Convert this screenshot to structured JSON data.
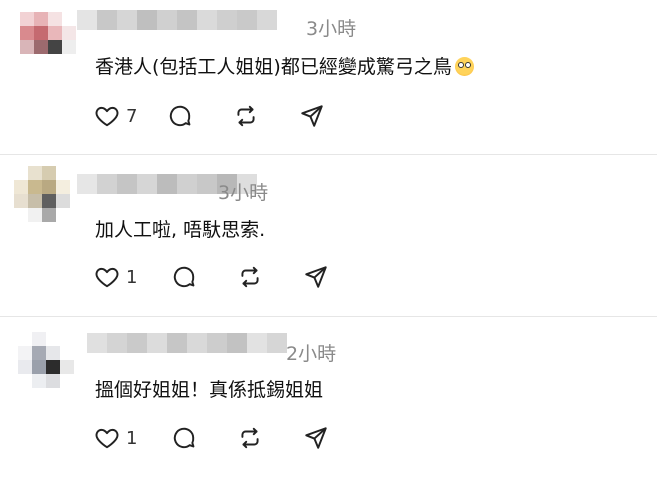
{
  "comments": [
    {
      "time": "3小時",
      "text": "香港人(包括工人姐姐)都已經變成驚弓之鳥",
      "emoji": "flushed-face-emoji",
      "like_count": "7",
      "avatar_colors": [
        "#f2d2d4",
        "#e7b3b6",
        "#f5e2e3",
        "#ffffff",
        "#d98a8e",
        "#c56a70",
        "#e9b7ba",
        "#f4e6e7",
        "#d9b5b8",
        "#9c6a6e",
        "#444444",
        "#eeeeee",
        "#ffffff",
        "#ffffff",
        "#ffffff",
        "#ffffff"
      ],
      "name_colors": [
        "#e4e4e4",
        "#c8c8c8",
        "#d6d6d6",
        "#bfbfbf",
        "#d0d0d0",
        "#c4c4c4",
        "#dadada",
        "#cfcfcf",
        "#c9c9c9",
        "#d8d8d8"
      ]
    },
    {
      "time": "3小時",
      "text": "加人工啦, 唔馱思索.",
      "like_count": "1",
      "avatar_colors": [
        "#ffffff",
        "#e8e1cf",
        "#d6ccb0",
        "#ffffff",
        "#efe7d5",
        "#c9b98f",
        "#b9a982",
        "#f4eedf",
        "#e7dfd0",
        "#c7bea9",
        "#5f5f5f",
        "#dcdcdc",
        "#ffffff",
        "#f1f1f1",
        "#a9a9a9",
        "#ffffff"
      ],
      "name_colors": [
        "#e6e6e6",
        "#d2d2d2",
        "#c5c5c5",
        "#d6d6d6",
        "#bcbcbc",
        "#d0d0d0",
        "#c8c8c8",
        "#b8b8b8",
        "#dedede"
      ]
    },
    {
      "time": "2小時",
      "text": "搵個好姐姐！真係抵錫姐姐",
      "like_count": "1",
      "avatar_colors": [
        "#ffffff",
        "#f0f0f3",
        "#ffffff",
        "#ffffff",
        "#f3f3f5",
        "#a6aab4",
        "#e6e7ea",
        "#ffffff",
        "#e9eaee",
        "#9aa0ab",
        "#2c2c2c",
        "#e8e8e8",
        "#ffffff",
        "#eceef1",
        "#dcdde0",
        "#ffffff"
      ],
      "name_colors": [
        "#e0e0e0",
        "#d4d4d4",
        "#cacaca",
        "#dcdcdc",
        "#c6c6c6",
        "#d9d9d9",
        "#cdcdcd",
        "#c2c2c2",
        "#e2e2e2",
        "#d6d6d6"
      ]
    }
  ],
  "actions": [
    "like-icon",
    "comment-icon",
    "repost-icon",
    "share-icon"
  ]
}
